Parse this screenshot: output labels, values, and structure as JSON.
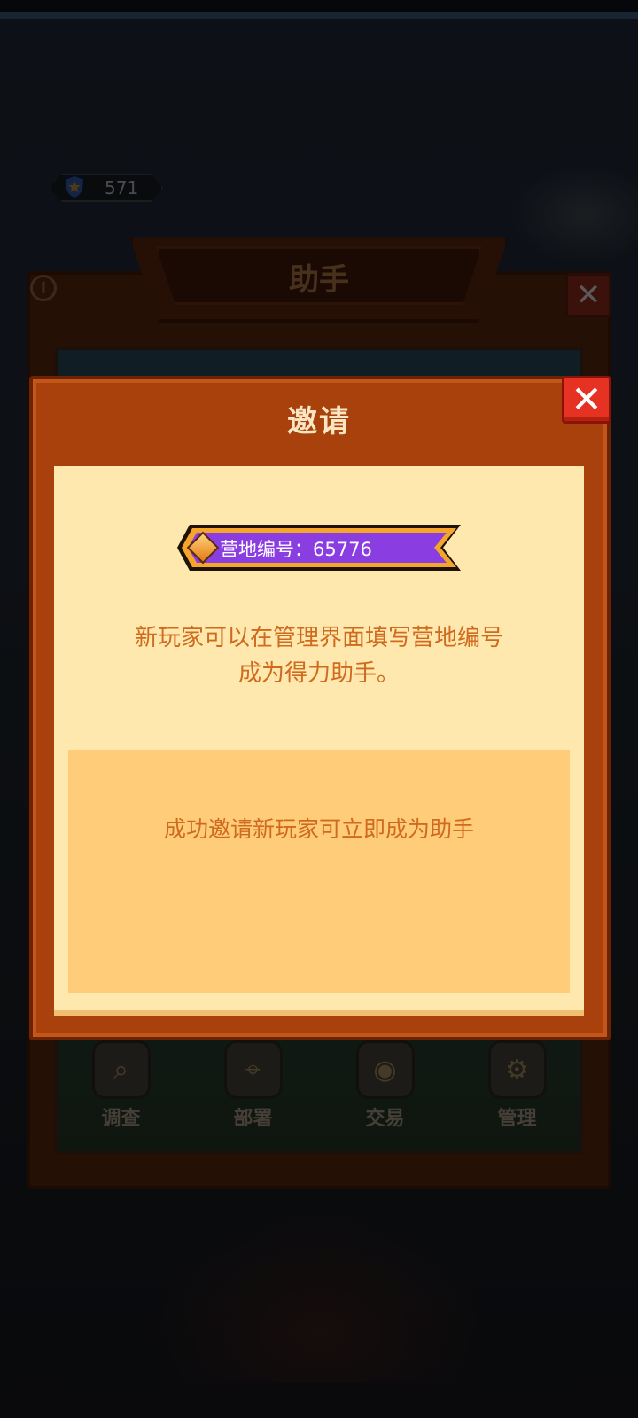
{
  "status_bar": {},
  "currency": {
    "icon": "shield-trophy-icon",
    "value": "571"
  },
  "back_panel": {
    "title": "助手",
    "info_icon": "info-icon",
    "close_icon": "close-icon",
    "tabs": [
      {
        "label": "调查",
        "icon": "magnifier-clipboard-icon"
      },
      {
        "label": "部署",
        "icon": "map-pin-icon"
      },
      {
        "label": "交易",
        "icon": "trade-machine-icon"
      },
      {
        "label": "管理",
        "icon": "gear-icon"
      }
    ]
  },
  "modal": {
    "title": "邀请",
    "close_icon": "close-icon",
    "camp_label": "营地编号：65776",
    "camp_icon": "gem-icon",
    "description_line1": "新玩家可以在管理界面填写营地编号",
    "description_line2": "成为得力助手。",
    "tip": "成功邀请新玩家可立即成为助手"
  },
  "colors": {
    "modal_bg": "#a8410c",
    "content_bg": "#ffe8ad",
    "tip_bg": "#ffcd7a",
    "text_orange": "#d06a1e",
    "close_red": "#e53222",
    "banner_purple": "#8a3ee2"
  }
}
